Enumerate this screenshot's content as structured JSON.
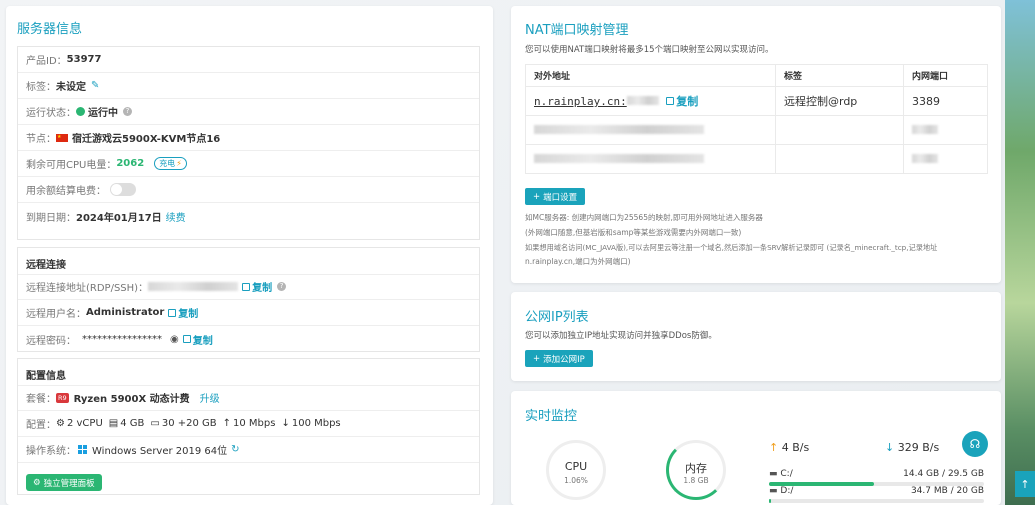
{
  "server_info": {
    "title": "服务器信息",
    "product_id_label": "产品ID：",
    "product_id": "53977",
    "tag_label": "标签：",
    "tag_value": "未设定",
    "status_label": "运行状态：",
    "status_value": "运行中",
    "node_label": "节点：",
    "node_value": "宿迁游戏云5900X-KVM节点16",
    "cpu_power_label": "剩余可用CPU电量：",
    "cpu_power_value": "2062",
    "recharge_label": "充电",
    "balance_label": "用余额结算电费：",
    "expire_label": "到期日期：",
    "expire_value": "2024年01月17日",
    "renew_label": "续费"
  },
  "remote": {
    "title": "远程连接",
    "address_label": "远程连接地址(RDP/SSH)：",
    "copy_label": "复制",
    "user_label": "远程用户名：",
    "user_value": "Administrator",
    "password_label": "远程密码：",
    "password_value": "****************"
  },
  "config": {
    "title": "配置信息",
    "plan_label": "套餐：",
    "plan_badge": "R9",
    "plan_value": "Ryzen 5900X 动态计费",
    "upgrade_label": "升级",
    "spec_label": "配置：",
    "cpu": "2 vCPU",
    "ram": "4 GB",
    "disk": "30 +20 GB",
    "up_speed": "10 Mbps",
    "down_speed": "100 Mbps",
    "os_label": "操作系统：",
    "os_value": "Windows Server 2019 64位",
    "panel_button": "独立管理面板"
  },
  "nat": {
    "title": "NAT端口映射管理",
    "desc": "您可以使用NAT端口映射将最多15个端口映射至公网以实现访问。",
    "columns": [
      "对外地址",
      "标签",
      "内网端口"
    ],
    "row1": {
      "address": "n.rainplay.cn:",
      "copy": "复制",
      "tag": "远程控制@rdp",
      "port": "3389"
    },
    "settings_button": "端口设置",
    "note1": "如MC服务器: 创建内网端口为25565的映射,即可用外网地址进入服务器",
    "note2": "(外网端口随意,但基岩版和samp等某些游戏需要内外网端口一致)",
    "note3": "如果想用域名访问(MC_JAVA版),可以去阿里云等注册一个域名,然后添加一条SRV解析记录即可 (记录名_minecraft._tcp,记录地址",
    "note4": "n.rainplay.cn,端口为外网端口)"
  },
  "public_ip": {
    "title": "公网IP列表",
    "desc": "您可以添加独立IP地址实现访问并独享DDos防御。",
    "add_button": "添加公网IP"
  },
  "monitor": {
    "title": "实时监控",
    "cpu_label": "CPU",
    "cpu_value": "1.06%",
    "cpu_percent": 1.06,
    "mem_label": "内存",
    "mem_value": "1.8 GB",
    "upload": "4 B/s",
    "download": "329 B/s",
    "disks": [
      {
        "name": "C:/",
        "usage": "14.4 GB / 29.5 GB",
        "fraction": 0.49
      },
      {
        "name": "D:/",
        "usage": "34.7 MB / 20 GB",
        "fraction": 0.01
      }
    ]
  },
  "colors": {
    "accent": "#1a9fbf",
    "success": "#2bb673"
  }
}
